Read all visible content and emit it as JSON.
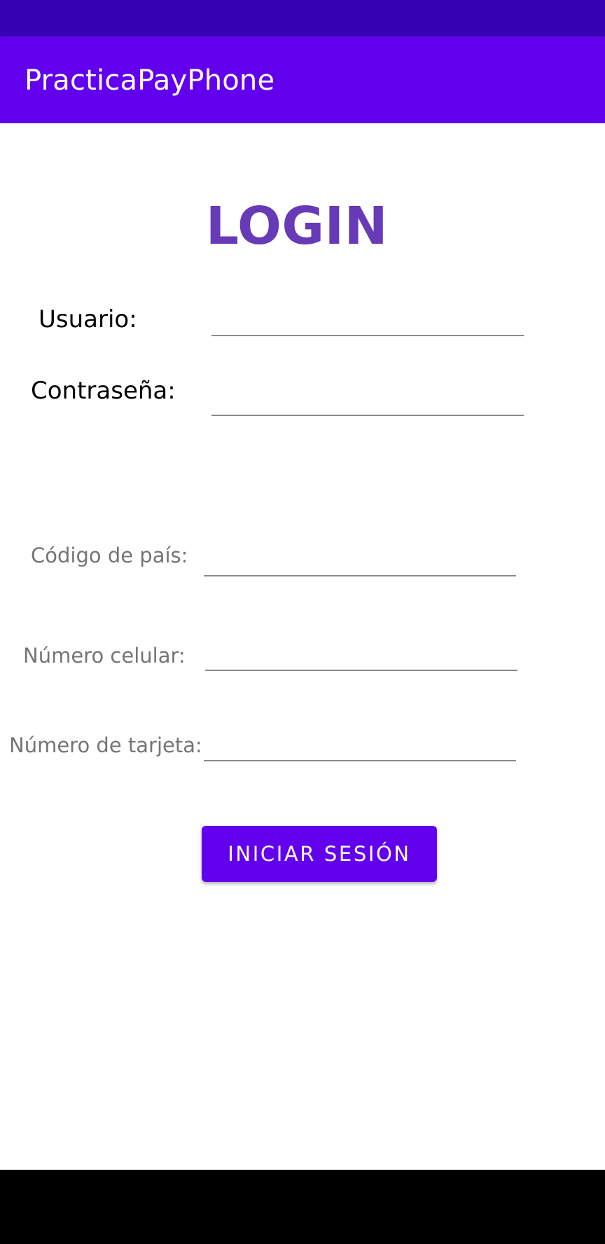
{
  "app_bar": {
    "title": "PracticaPayPhone"
  },
  "login": {
    "title": "LOGIN",
    "fields": [
      {
        "label": "Usuario:",
        "value": ""
      },
      {
        "label": "Contraseña:",
        "value": ""
      },
      {
        "label": "Código de país:",
        "value": ""
      },
      {
        "label": "Número celular:",
        "value": ""
      },
      {
        "label": "Número de tarjeta:",
        "value": ""
      }
    ],
    "submit_label": "INICIAR SESIÓN"
  },
  "colors": {
    "status_bar": "#3700b3",
    "app_bar": "#6200ee",
    "title_text": "#673ab7",
    "button": "#6200ee",
    "nav_bar": "#000000"
  }
}
